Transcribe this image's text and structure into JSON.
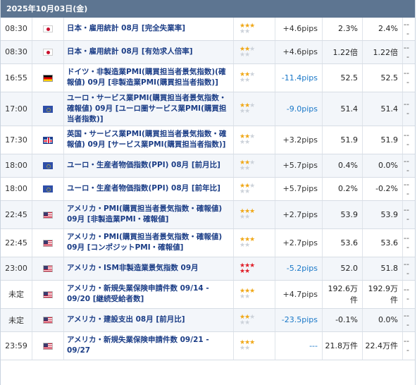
{
  "header": {
    "date": "2025年10月03日(金)"
  },
  "colors": {
    "star_on": "#f0a818",
    "star_high": "#e0202a",
    "negative_pips": "#1a78c8",
    "event_text": "#1b3d86",
    "header_bg": "#5d7591"
  },
  "rows": [
    {
      "time": "08:30",
      "flag": "japan-flag-icon",
      "event": "日本・雇用統計 08月 [完全失業率]",
      "stars": 3,
      "pips": "+4.6pips",
      "prev": "2.3%",
      "fore": "2.4%",
      "act": "---"
    },
    {
      "time": "08:30",
      "flag": "japan-flag-icon",
      "event": "日本・雇用統計 08月 [有効求人倍率]",
      "stars": 2,
      "pips": "+4.6pips",
      "prev": "1.22倍",
      "fore": "1.22倍",
      "act": "---"
    },
    {
      "time": "16:55",
      "flag": "germany-flag-icon",
      "event": "ドイツ・非製造業PMI(購買担当者景気指数)(確報値) 09月 [非製造業PMI(購買担当者指数)]",
      "stars": 2,
      "pips": "-11.4pips",
      "prev": "52.5",
      "fore": "52.5",
      "act": "---"
    },
    {
      "time": "17:00",
      "flag": "eu-flag-icon",
      "event": "ユーロ・サービス業PMI(購買担当者景気指数・確報値) 09月 [ユーロ圏サービス業PMI(購買担当者指数)]",
      "stars": 2,
      "pips": "-9.0pips",
      "prev": "51.4",
      "fore": "51.4",
      "act": "---"
    },
    {
      "time": "17:30",
      "flag": "uk-flag-icon",
      "event": "英国・サービス業PMI(購買担当者景気指数・確報値) 09月 [サービス業PMI(購買担当者指数)]",
      "stars": 2,
      "pips": "+3.2pips",
      "prev": "51.9",
      "fore": "51.9",
      "act": "---"
    },
    {
      "time": "18:00",
      "flag": "eu-flag-icon",
      "event": "ユーロ・生産者物価指数(PPI) 08月 [前月比]",
      "stars": 2,
      "pips": "+5.7pips",
      "prev": "0.4%",
      "fore": "0.0%",
      "act": "---"
    },
    {
      "time": "18:00",
      "flag": "eu-flag-icon",
      "event": "ユーロ・生産者物価指数(PPI) 08月 [前年比]",
      "stars": 2,
      "pips": "+5.7pips",
      "prev": "0.2%",
      "fore": "-0.2%",
      "act": "---"
    },
    {
      "time": "22:45",
      "flag": "us-flag-icon",
      "event": "アメリカ・PMI(購買担当者景気指数・確報値) 09月 [非製造業PMI・確報値]",
      "stars": 3,
      "pips": "+2.7pips",
      "prev": "53.9",
      "fore": "53.9",
      "act": "---"
    },
    {
      "time": "22:45",
      "flag": "us-flag-icon",
      "event": "アメリカ・PMI(購買担当者景気指数・確報値) 09月 [コンポジットPMI・確報値]",
      "stars": 3,
      "pips": "+2.7pips",
      "prev": "53.6",
      "fore": "53.6",
      "act": "---"
    },
    {
      "time": "23:00",
      "flag": "us-flag-icon",
      "event": "アメリカ・ISM非製造業景気指数 09月",
      "stars": 5,
      "pips": "-5.2pips",
      "prev": "52.0",
      "fore": "51.8",
      "act": "---"
    },
    {
      "time": "未定",
      "flag": "us-flag-icon",
      "event": "アメリカ・新規失業保険申請件数 09/14 - 09/20 [継続受給者数]",
      "stars": 3,
      "pips": "+4.7pips",
      "prev": "192.6万件",
      "fore": "192.9万件",
      "act": "---"
    },
    {
      "time": "未定",
      "flag": "us-flag-icon",
      "event": "アメリカ・建設支出 08月 [前月比]",
      "stars": 2,
      "pips": "-23.5pips",
      "prev": "-0.1%",
      "fore": "0.0%",
      "act": "---"
    },
    {
      "time": "23:59",
      "flag": "us-flag-icon",
      "event": "アメリカ・新規失業保険申請件数 09/21 - 09/27",
      "stars": 3,
      "pips": "---",
      "prev": "21.8万件",
      "fore": "22.4万件",
      "act": "---"
    }
  ]
}
